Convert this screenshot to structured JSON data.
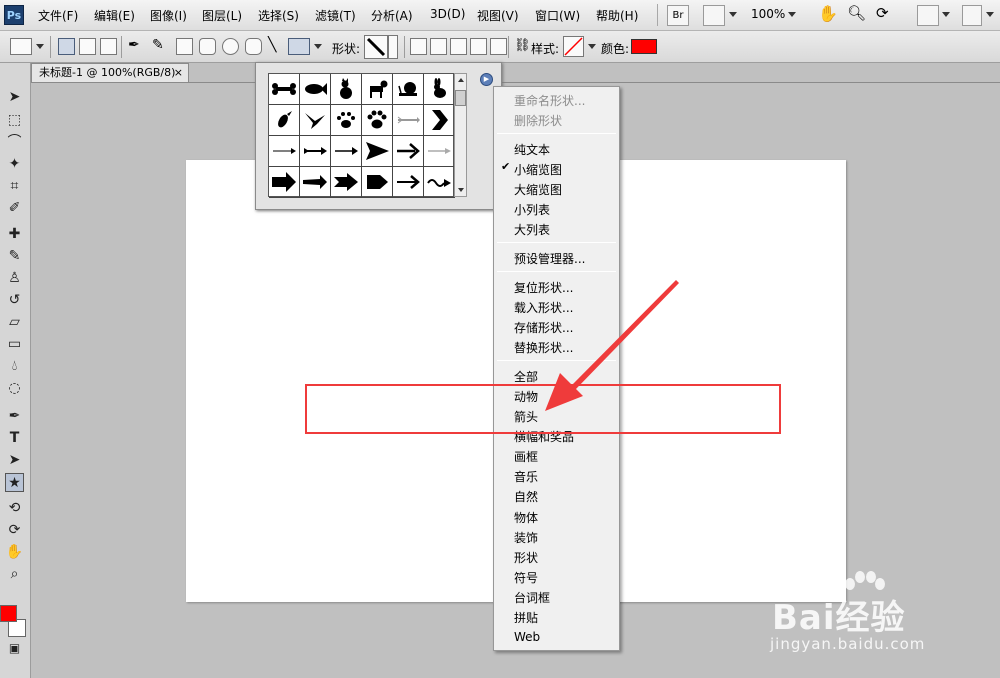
{
  "app": {
    "logo": "Ps"
  },
  "menubar": {
    "items": [
      "文件(F)",
      "编辑(E)",
      "图像(I)",
      "图层(L)",
      "选择(S)",
      "滤镜(T)",
      "分析(A)",
      "3D(D)",
      "视图(V)",
      "窗口(W)",
      "帮助(H)"
    ],
    "bridge_label": "Br",
    "zoom": "100%"
  },
  "options_bar": {
    "shape_label": "形状:",
    "style_label": "样式:",
    "color_label": "颜色:",
    "color": "#ff0000"
  },
  "document": {
    "tab_title": "未标题-1 @ 100%(RGB/8)",
    "close_glyph": "×"
  },
  "toolbar": {
    "foreground_color": "#ff0000",
    "background_color": "#ffffff",
    "tools": [
      "move-tool-icon",
      "marquee-tool-icon",
      "lasso-tool-icon",
      "magic-wand-tool-icon",
      "crop-tool-icon",
      "eyedropper-tool-icon",
      "healing-brush-tool-icon",
      "brush-tool-icon",
      "clone-stamp-tool-icon",
      "history-brush-tool-icon",
      "eraser-tool-icon",
      "gradient-tool-icon",
      "blur-tool-icon",
      "dodge-tool-icon",
      "pen-tool-icon",
      "type-tool-icon",
      "path-selection-tool-icon",
      "custom-shape-tool-icon",
      "3d-rotate-tool-icon",
      "3d-orbit-tool-icon",
      "hand-tool-icon",
      "zoom-tool-icon"
    ]
  },
  "shape_picker": {
    "shapes": [
      "bone-shape",
      "fish-shape",
      "cat-shape",
      "dog-shape",
      "snail-shape",
      "rabbit-shape",
      "bird-shape",
      "dove-shape",
      "paw-print-shape",
      "paw-print-2-shape",
      "arrow-feather-shape",
      "chevron-arrow-shape",
      "arrow-thin-shape",
      "arrow-fletched-shape",
      "arrow-line-shape",
      "arrow-triangle-shape",
      "arrow-bold-shape",
      "arrow-light-shape",
      "arrow-block-shape",
      "arrow-tapered-shape",
      "arrow-notched-shape",
      "arrow-pentagon-shape",
      "arrow-curved-shape",
      "arrow-wavy-shape"
    ]
  },
  "context_menu": {
    "items": [
      {
        "label": "重命名形状...",
        "disabled": true
      },
      {
        "label": "删除形状",
        "disabled": true
      },
      {
        "label": "纯文本"
      },
      {
        "label": "小缩览图",
        "checked": true
      },
      {
        "label": "大缩览图"
      },
      {
        "label": "小列表"
      },
      {
        "label": "大列表"
      },
      {
        "label": "预设管理器..."
      },
      {
        "label": "复位形状..."
      },
      {
        "label": "载入形状..."
      },
      {
        "label": "存储形状..."
      },
      {
        "label": "替换形状..."
      },
      {
        "label": "全部"
      },
      {
        "label": "动物"
      },
      {
        "label": "箭头"
      },
      {
        "label": "横幅和奖品"
      },
      {
        "label": "画框"
      },
      {
        "label": "音乐"
      },
      {
        "label": "自然"
      },
      {
        "label": "物体"
      },
      {
        "label": "装饰"
      },
      {
        "label": "形状"
      },
      {
        "label": "符号"
      },
      {
        "label": "台词框"
      },
      {
        "label": "拼贴"
      },
      {
        "label": "Web"
      }
    ],
    "check_glyph": "✔"
  },
  "annotation": {
    "color": "#ef3b3b"
  },
  "watermark": {
    "brand": "Bai经验",
    "url": "jingyan.baidu.com"
  }
}
